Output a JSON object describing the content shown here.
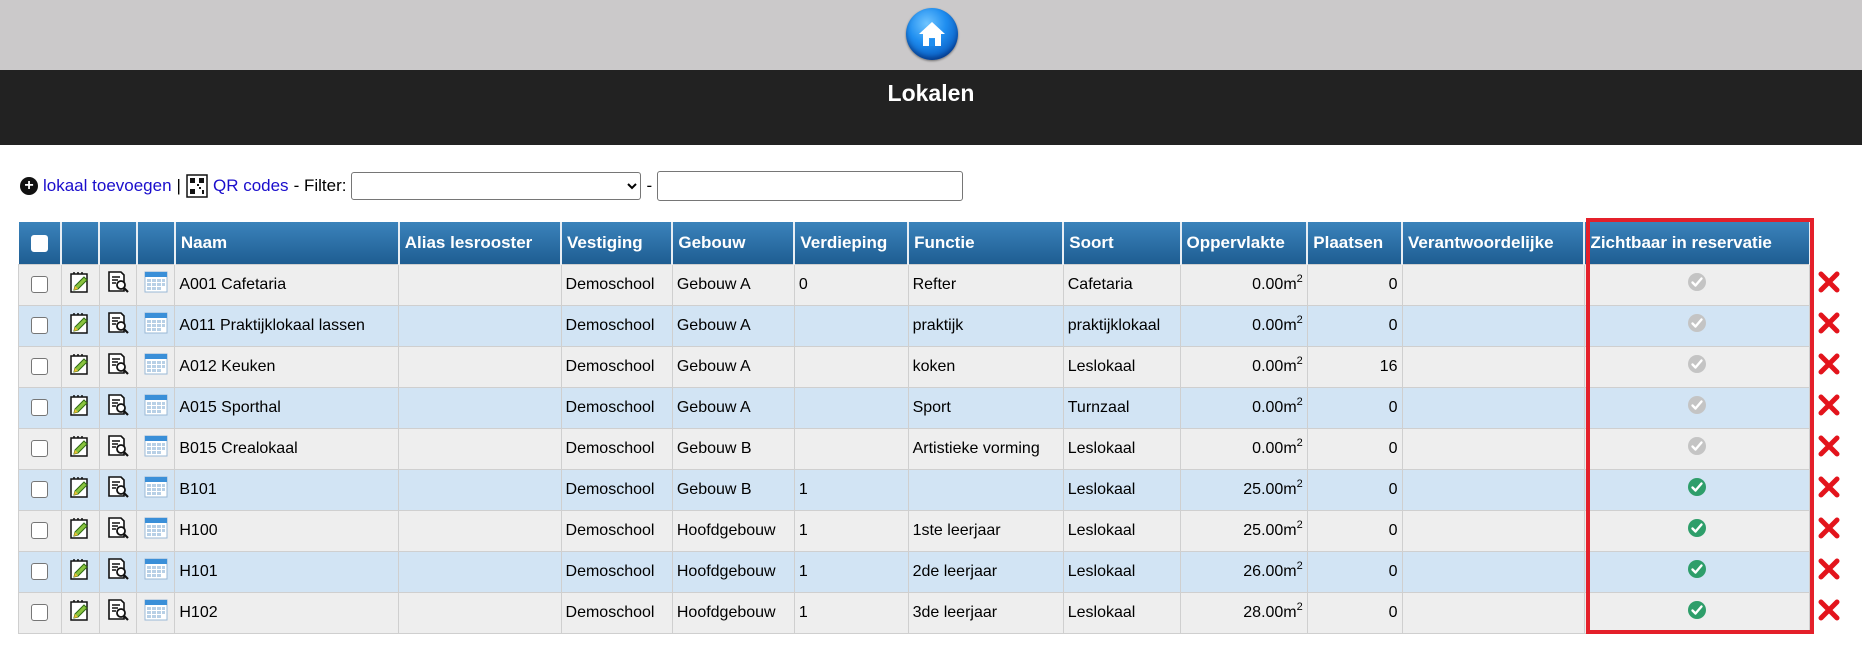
{
  "header": {
    "title": "Lokalen"
  },
  "toolbar": {
    "add_label": "lokaal toevoegen",
    "separator": "|",
    "qr_label": "QR codes",
    "filter_label": "- Filter:",
    "dash": "-",
    "filter_value": "",
    "search_value": ""
  },
  "columns": [
    "Naam",
    "Alias lesrooster",
    "Vestiging",
    "Gebouw",
    "Verdieping",
    "Functie",
    "Soort",
    "Oppervlakte",
    "Plaatsen",
    "Verantwoordelijke",
    "Zichtbaar in reservatie"
  ],
  "rows": [
    {
      "naam": "A001 Cafetaria",
      "alias": "",
      "vestiging": "Demoschool",
      "gebouw": "Gebouw A",
      "verdieping": "0",
      "functie": "Refter",
      "soort": "Cafetaria",
      "oppervlakte": "0.00m",
      "unit_sup": "2",
      "plaatsen": "0",
      "verantwoordelijke": "",
      "zichtbaar": false
    },
    {
      "naam": "A011 Praktijklokaal lassen",
      "alias": "",
      "vestiging": "Demoschool",
      "gebouw": "Gebouw A",
      "verdieping": "",
      "functie": "praktijk",
      "soort": "praktijklokaal",
      "oppervlakte": "0.00m",
      "unit_sup": "2",
      "plaatsen": "0",
      "verantwoordelijke": "",
      "zichtbaar": false
    },
    {
      "naam": "A012 Keuken",
      "alias": "",
      "vestiging": "Demoschool",
      "gebouw": "Gebouw A",
      "verdieping": "",
      "functie": "koken",
      "soort": "Leslokaal",
      "oppervlakte": "0.00m",
      "unit_sup": "2",
      "plaatsen": "16",
      "verantwoordelijke": "",
      "zichtbaar": false
    },
    {
      "naam": "A015 Sporthal",
      "alias": "",
      "vestiging": "Demoschool",
      "gebouw": "Gebouw A",
      "verdieping": "",
      "functie": "Sport",
      "soort": "Turnzaal",
      "oppervlakte": "0.00m",
      "unit_sup": "2",
      "plaatsen": "0",
      "verantwoordelijke": "",
      "zichtbaar": false
    },
    {
      "naam": "B015 Crealokaal",
      "alias": "",
      "vestiging": "Demoschool",
      "gebouw": "Gebouw B",
      "verdieping": "",
      "functie": "Artistieke vorming",
      "soort": "Leslokaal",
      "oppervlakte": "0.00m",
      "unit_sup": "2",
      "plaatsen": "0",
      "verantwoordelijke": "",
      "zichtbaar": false
    },
    {
      "naam": "B101",
      "alias": "",
      "vestiging": "Demoschool",
      "gebouw": "Gebouw B",
      "verdieping": "1",
      "functie": "",
      "soort": "Leslokaal",
      "oppervlakte": "25.00m",
      "unit_sup": "2",
      "plaatsen": "0",
      "verantwoordelijke": "",
      "zichtbaar": true
    },
    {
      "naam": "H100",
      "alias": "",
      "vestiging": "Demoschool",
      "gebouw": "Hoofdgebouw",
      "verdieping": "1",
      "functie": "1ste leerjaar",
      "soort": "Leslokaal",
      "oppervlakte": "25.00m",
      "unit_sup": "2",
      "plaatsen": "0",
      "verantwoordelijke": "",
      "zichtbaar": true
    },
    {
      "naam": "H101",
      "alias": "",
      "vestiging": "Demoschool",
      "gebouw": "Hoofdgebouw",
      "verdieping": "1",
      "functie": "2de leerjaar",
      "soort": "Leslokaal",
      "oppervlakte": "26.00m",
      "unit_sup": "2",
      "plaatsen": "0",
      "verantwoordelijke": "",
      "zichtbaar": true
    },
    {
      "naam": "H102",
      "alias": "",
      "vestiging": "Demoschool",
      "gebouw": "Hoofdgebouw",
      "verdieping": "1",
      "functie": "3de leerjaar",
      "soort": "Leslokaal",
      "oppervlakte": "28.00m",
      "unit_sup": "2",
      "plaatsen": "0",
      "verantwoordelijke": "",
      "zichtbaar": true
    }
  ],
  "colors": {
    "header_bg": "#222222",
    "topbar_bg": "#cbc9ca",
    "table_head": "#2f74ad",
    "row_odd": "#eeeeee",
    "row_even": "#d2e4f4",
    "highlight": "#e4202a",
    "check_on": "#2e9e6a",
    "check_off": "#c4c4c4",
    "delete": "#e3141c"
  },
  "icons": {
    "home": "home-icon",
    "add": "plus-circle-icon",
    "qr": "qr-code-icon",
    "edit": "edit-note-icon",
    "view": "document-search-icon",
    "calendar": "calendar-icon",
    "visible": "check-circle-icon",
    "delete": "delete-x-icon"
  }
}
